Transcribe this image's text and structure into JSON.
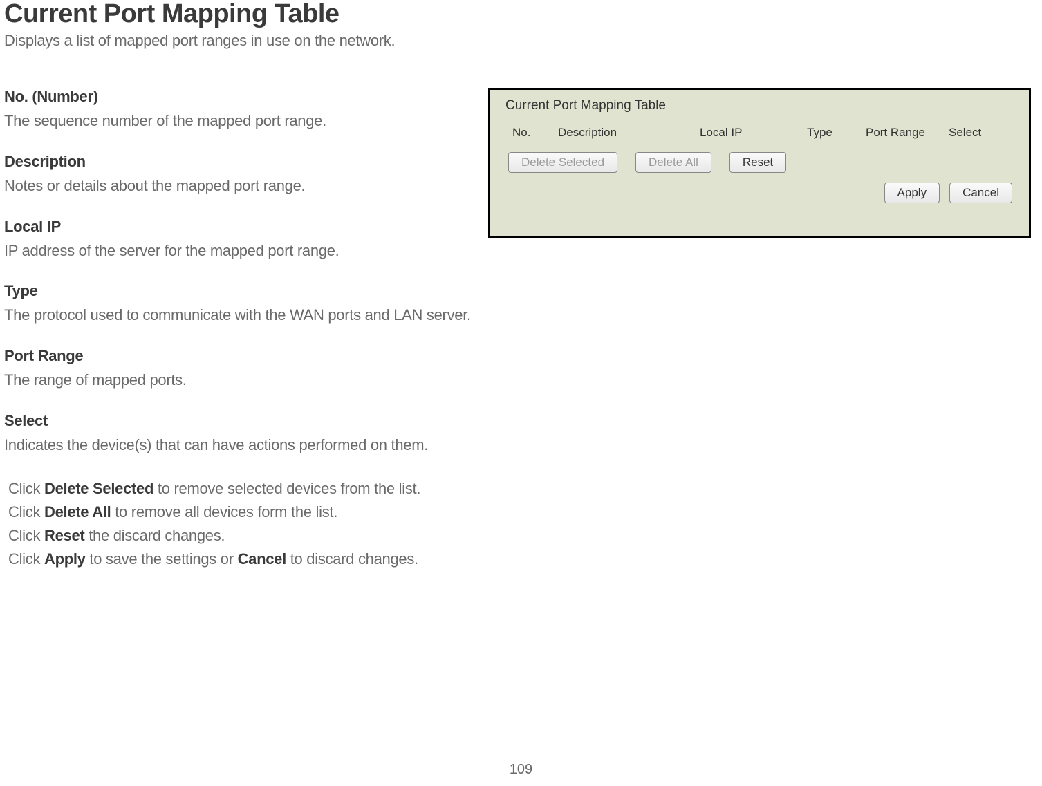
{
  "page": {
    "title": "Current Port Mapping Table",
    "subtitle": "Displays a list of mapped port ranges in use on the network.",
    "number": "109"
  },
  "definitions": [
    {
      "term": "No. (Number)",
      "desc": "The sequence number of the mapped port range."
    },
    {
      "term": "Description",
      "desc": "Notes or details about the mapped port range."
    },
    {
      "term": "Local IP",
      "desc": "IP address of the server for the mapped port range."
    },
    {
      "term": "Type",
      "desc": "The protocol used to communicate with the WAN ports and LAN server."
    },
    {
      "term": "Port Range",
      "desc": "The range of mapped ports."
    },
    {
      "term": "Select",
      "desc": "Indicates the device(s) that can have actions performed on them."
    }
  ],
  "instructions": {
    "line1_pre": "Click ",
    "line1_bold": "Delete Selected",
    "line1_post": " to remove selected devices from the list.",
    "line2_pre": "Click ",
    "line2_bold": "Delete All",
    "line2_post": " to remove all devices form the list.",
    "line3_pre": "Click ",
    "line3_bold": "Reset",
    "line3_post": " the discard changes.",
    "line4_pre": "Click ",
    "line4_bold1": "Apply",
    "line4_mid": " to save the settings or ",
    "line4_bold2": "Cancel",
    "line4_post": " to discard changes."
  },
  "panel": {
    "title": "Current Port Mapping Table",
    "columns": {
      "no": "No.",
      "description": "Description",
      "local_ip": "Local IP",
      "type": "Type",
      "port_range": "Port Range",
      "select": "Select"
    },
    "buttons": {
      "delete_selected": "Delete Selected",
      "delete_all": "Delete All",
      "reset": "Reset",
      "apply": "Apply",
      "cancel": "Cancel"
    }
  }
}
